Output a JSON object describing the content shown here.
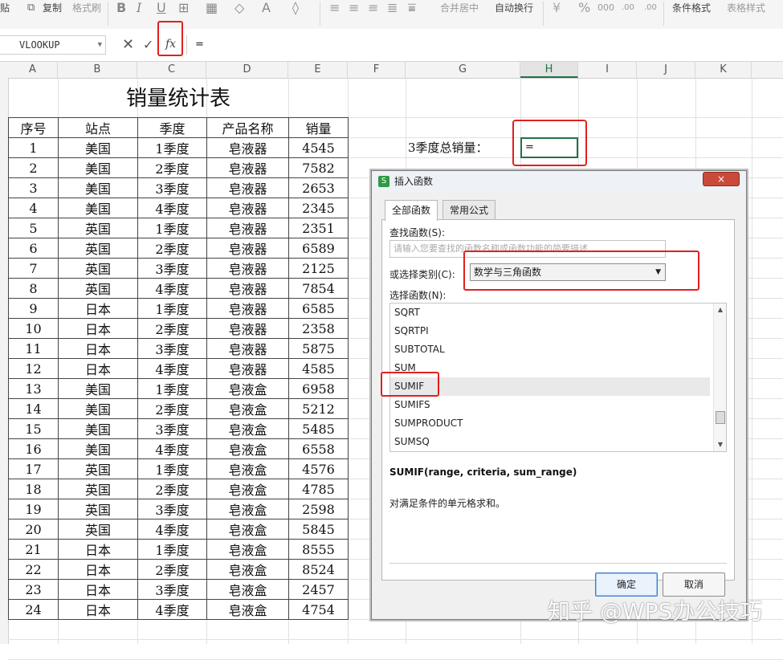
{
  "ribbon": {
    "paste": "贴",
    "copy": "复制",
    "format_painter": "格式刷",
    "merge_center": "合并居中",
    "wrap_text": "自动换行",
    "conditional_format": "条件格式",
    "table_style": "表格样式",
    "decimal_increase": ".00",
    "decimal_decrease": ".00"
  },
  "formula_bar": {
    "name_box": "VLOOKUP",
    "formula": "="
  },
  "columns": [
    "A",
    "B",
    "C",
    "D",
    "E",
    "F",
    "G",
    "H",
    "I",
    "J",
    "K"
  ],
  "sheet": {
    "title": "销量统计表",
    "headers": [
      "序号",
      "站点",
      "季度",
      "产品名称",
      "销量"
    ],
    "rows": [
      [
        "1",
        "美国",
        "1季度",
        "皂液器",
        "4545"
      ],
      [
        "2",
        "美国",
        "2季度",
        "皂液器",
        "7582"
      ],
      [
        "3",
        "美国",
        "3季度",
        "皂液器",
        "2653"
      ],
      [
        "4",
        "美国",
        "4季度",
        "皂液器",
        "2345"
      ],
      [
        "5",
        "英国",
        "1季度",
        "皂液器",
        "2351"
      ],
      [
        "6",
        "英国",
        "2季度",
        "皂液器",
        "6589"
      ],
      [
        "7",
        "英国",
        "3季度",
        "皂液器",
        "2125"
      ],
      [
        "8",
        "英国",
        "4季度",
        "皂液器",
        "7854"
      ],
      [
        "9",
        "日本",
        "1季度",
        "皂液器",
        "6585"
      ],
      [
        "10",
        "日本",
        "2季度",
        "皂液器",
        "2358"
      ],
      [
        "11",
        "日本",
        "3季度",
        "皂液器",
        "5875"
      ],
      [
        "12",
        "日本",
        "4季度",
        "皂液器",
        "4585"
      ],
      [
        "13",
        "美国",
        "1季度",
        "皂液盒",
        "6958"
      ],
      [
        "14",
        "美国",
        "2季度",
        "皂液盒",
        "5212"
      ],
      [
        "15",
        "美国",
        "3季度",
        "皂液盒",
        "5485"
      ],
      [
        "16",
        "美国",
        "4季度",
        "皂液盒",
        "6558"
      ],
      [
        "17",
        "英国",
        "1季度",
        "皂液盒",
        "4576"
      ],
      [
        "18",
        "英国",
        "2季度",
        "皂液盒",
        "4785"
      ],
      [
        "19",
        "英国",
        "3季度",
        "皂液盒",
        "2598"
      ],
      [
        "20",
        "英国",
        "4季度",
        "皂液盒",
        "5845"
      ],
      [
        "21",
        "日本",
        "1季度",
        "皂液盒",
        "8555"
      ],
      [
        "22",
        "日本",
        "2季度",
        "皂液盒",
        "8524"
      ],
      [
        "23",
        "日本",
        "3季度",
        "皂液盒",
        "2457"
      ],
      [
        "24",
        "日本",
        "4季度",
        "皂液盒",
        "4754"
      ]
    ],
    "total_label": "3季度总销量：",
    "active_cell_value": "="
  },
  "dialog": {
    "title": "插入函数",
    "close": "×",
    "tabs": [
      "全部函数",
      "常用公式"
    ],
    "search_label": "查找函数(S):",
    "search_placeholder": "请输入您要查找的函数名称或函数功能的简要描述",
    "category_label": "或选择类别(C):",
    "category_value": "数学与三角函数",
    "list_label": "选择函数(N):",
    "functions": [
      "SQRT",
      "SQRTPI",
      "SUBTOTAL",
      "SUM",
      "SUMIF",
      "SUMIFS",
      "SUMPRODUCT",
      "SUMSQ"
    ],
    "selected_function": "SUMIF",
    "signature": "SUMIF(range, criteria, sum_range)",
    "description": "对满足条件的单元格求和。",
    "ok": "确定",
    "cancel": "取消"
  },
  "watermark": "知乎 @WPS办公技巧",
  "colors": {
    "highlight_red": "#e02020",
    "excel_green": "#217346",
    "dialog_bg": "#f0f0f0"
  }
}
